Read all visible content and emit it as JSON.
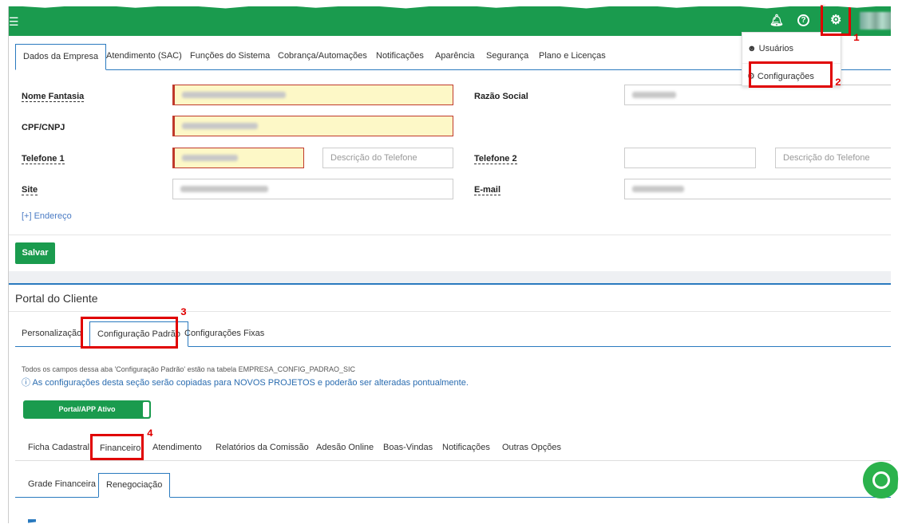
{
  "topbar": {
    "menu_icon": "hamburger-icon",
    "icons": [
      "bell-icon",
      "help-icon",
      "gear-icon"
    ]
  },
  "main_tabs": [
    {
      "label": "Dados da Empresa"
    },
    {
      "label": "Atendimento (SAC)"
    },
    {
      "label": "Funções do Sistema"
    },
    {
      "label": "Cobrança/Automações"
    },
    {
      "label": "Notificações"
    },
    {
      "label": "Aparência"
    },
    {
      "label": "Segurança"
    },
    {
      "label": "Plano e Licenças"
    }
  ],
  "form": {
    "nome_fantasia": "Nome Fantasia",
    "razao_social": "Razão Social",
    "cpf_cnpj": "CPF/CNPJ",
    "telefone1": "Telefone 1",
    "telefone2": "Telefone 2",
    "descricao_placeholder": "Descrição do Telefone",
    "site": "Site",
    "email": "E-mail",
    "endereco_link": "[+] Endereço",
    "save": "Salvar"
  },
  "dropdown": {
    "usuarios": "Usuários",
    "configuracoes": "Configurações"
  },
  "portal": {
    "title": "Portal do Cliente",
    "tabs": [
      "Personalização",
      "Configuração Padrão",
      "Configurações Fixas"
    ],
    "note": "Todos os campos dessa aba 'Configuração Padrão' estão na tabela EMPRESA_CONFIG_PADRAO_SIC",
    "info": "As configurações desta seção serão copiadas para NOVOS PROJETOS e poderão ser alteradas pontualmente.",
    "toggle": "Portal/APP Ativo",
    "subtabs": [
      "Ficha Cadastral",
      "Financeiro",
      "Atendimento",
      "Relatórios da Comissão",
      "Adesão Online",
      "Boas-Vindas",
      "Notificações",
      "Outras Opções"
    ],
    "subsubtabs": [
      "Grade Financeira",
      "Renegociação"
    ]
  },
  "annotations": [
    "1",
    "2",
    "3",
    "4"
  ],
  "colors": {
    "brand": "#1a9b4e",
    "highlight": "#e00000",
    "link": "#4a7bc4"
  }
}
